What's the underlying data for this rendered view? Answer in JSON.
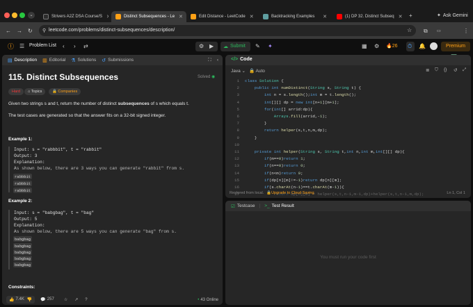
{
  "browser": {
    "tabs": [
      {
        "label": "Strivers A2Z DSA Course/S",
        "color": "#2d2d2d"
      },
      {
        "label": "Distinct Subsequences - Le",
        "color": "#ffa116"
      },
      {
        "label": "Edit Distance - LeetCode",
        "color": "#ffa116"
      },
      {
        "label": "Backtracking Examples",
        "color": "#5f9ea0"
      },
      {
        "label": "(1) DP 32. Distinct Subseq",
        "color": "#ff0000"
      }
    ],
    "ask_gemini": "Ask Gemini",
    "url": "leetcode.com/problems/distinct-subsequences/description/"
  },
  "lc": {
    "problem_list": "Problem List",
    "submit": "Submit",
    "streak": "26",
    "premium": "Premium"
  },
  "left": {
    "tabs": [
      "Description",
      "Editorial",
      "Solutions",
      "Submissions"
    ],
    "title": "115. Distinct Subsequences",
    "solved": "Solved",
    "chips": [
      "Hard",
      "Topics",
      "Companies"
    ],
    "desc_pre": "Given two strings s and t, return the number of distinct ",
    "desc_bold": "subsequences",
    "desc_post": " of s which equals t.",
    "desc2": "The test cases are generated so that the answer fits on a 32-bit signed integer.",
    "ex1_title": "Example 1:",
    "ex1_lines": [
      "Input: s = \"rabbbit\", t = \"rabbit\"",
      "Output: 3",
      "Explanation:",
      "As shown below, there are 3 ways you can generate \"rabbit\" from s."
    ],
    "ex1_boxes": [
      "rabbbit",
      "rabbbit",
      "rabbbit"
    ],
    "ex2_title": "Example 2:",
    "ex2_lines": [
      "Input: s = \"babgbag\", t = \"bag\"",
      "Output: 5",
      "Explanation:",
      "As shown below, there are 5 ways you can generate \"bag\" from s."
    ],
    "ex2_boxes": [
      "babgbag",
      "babgbag",
      "babgbag",
      "babgbag",
      "babgbag"
    ],
    "constraints": "Constraints:",
    "likes": "7.4K",
    "comments": "257",
    "online": "43 Online"
  },
  "editor": {
    "title": "Code",
    "lang": "Java",
    "auto": "Auto",
    "line_numbers": [
      "1",
      "2",
      "3",
      "4",
      "5",
      "6",
      "7",
      "8",
      "9",
      "10",
      "11",
      "12",
      "13",
      "14",
      "15",
      "16",
      "17"
    ],
    "restored": "Restored from local.",
    "upgrade": "Upgrade to Cloud Saving",
    "cursor": "Ln 1, Col 1"
  },
  "test": {
    "tab1": "Testcase",
    "tab2": "Test Result",
    "msg": "You must run your code first"
  }
}
